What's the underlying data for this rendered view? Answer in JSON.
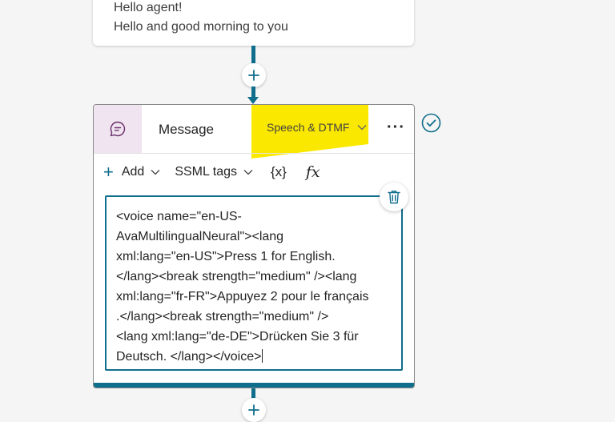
{
  "previous_message": {
    "lines": [
      "Hello agent!",
      "Hello and good morning to you"
    ]
  },
  "message_node": {
    "title": "Message",
    "mode_dropdown": "Speech & DTMF",
    "more_label": "···",
    "toolbar": {
      "add_label": "Add",
      "ssml_label": "SSML tags",
      "variable_label": "{x}",
      "formula_label": "fx"
    },
    "editor_lines": [
      "<voice name=\"en-US-",
      "AvaMultilingualNeural\"><lang",
      "xml:lang=\"en-US\">Press 1 for English.",
      "</lang><break strength=\"medium\" /><lang",
      "xml:lang=\"fr-FR\">Appuyez 2 pour le français",
      ".</lang><break strength=\"medium\" />",
      "<lang xml:lang=\"de-DE\">Drücken Sie 3 für",
      "Deutsch. </lang></voice>"
    ]
  },
  "colors": {
    "accent": "#0f6e8c",
    "highlight": "#fbe800",
    "icon_bg": "#efe4ef"
  }
}
